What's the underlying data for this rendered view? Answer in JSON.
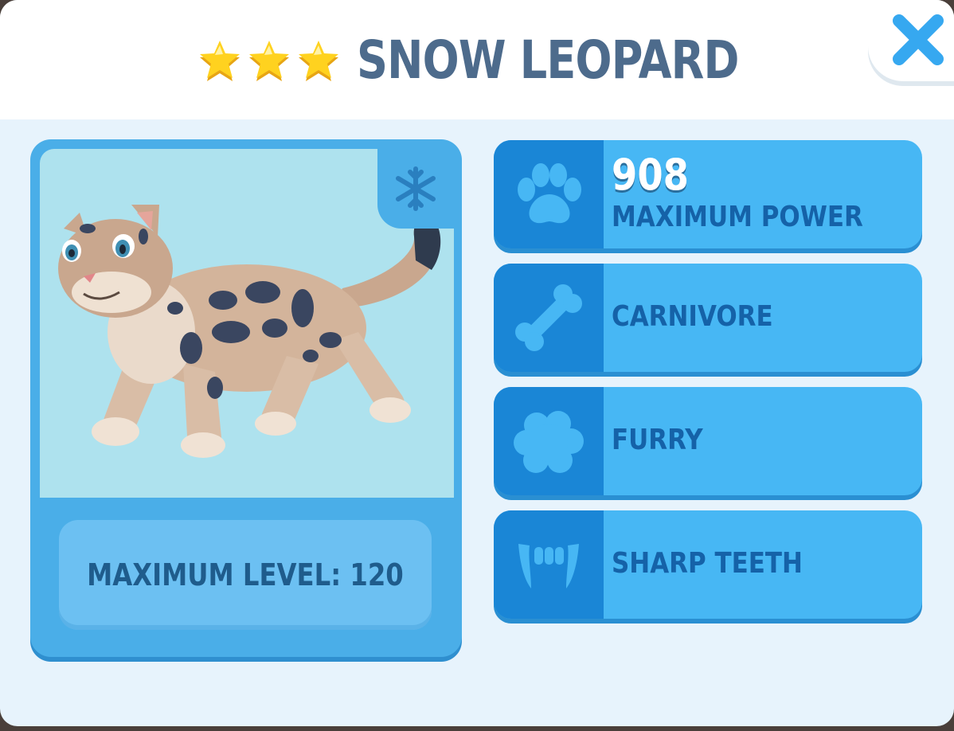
{
  "header": {
    "title": "SNOW LEOPARD",
    "stars": 3,
    "star_color": "#ffcf1f"
  },
  "close_button": {
    "icon": "close-icon",
    "color": "#36a8f0"
  },
  "animal_card": {
    "biome_icon": "snowflake-icon",
    "portrait": "snow-leopard",
    "max_level_text": "MAXIMUM LEVEL: 120"
  },
  "stats": [
    {
      "icon": "paw-icon",
      "value": "908",
      "label": "MAXIMUM POWER"
    },
    {
      "icon": "bone-icon",
      "label": "CARNIVORE"
    },
    {
      "icon": "fur-icon",
      "label": "FURRY"
    },
    {
      "icon": "fangs-icon",
      "label": "SHARP TEETH"
    }
  ],
  "colors": {
    "panel_bg": "#e7f3fc",
    "card_blue": "#4aaee8",
    "stat_blue": "#47b7f4",
    "icon_cell_blue": "#1a86d6",
    "title_color": "#4d6b8c"
  }
}
